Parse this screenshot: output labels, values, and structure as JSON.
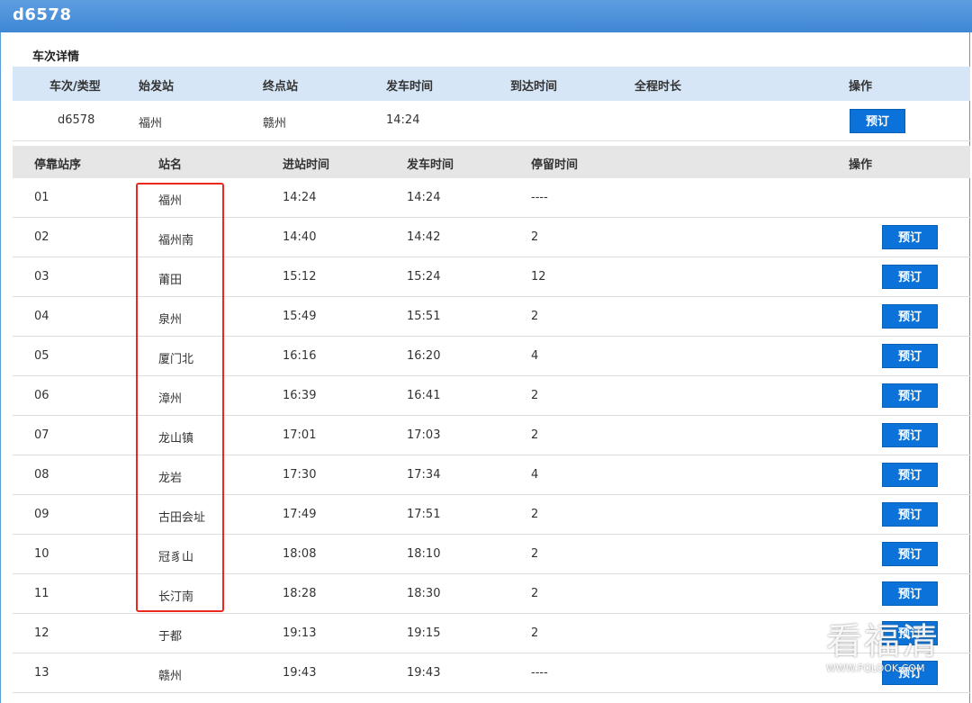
{
  "window": {
    "title": "d6578"
  },
  "section": {
    "label": "车次详情"
  },
  "train_header": {
    "columns": [
      "车次/类型",
      "始发站",
      "终点站",
      "发车时间",
      "到达时间",
      "全程时长",
      "操作"
    ]
  },
  "train_row": {
    "train_no": "d6578",
    "origin": "福州",
    "destination": "赣州",
    "depart": "14:24",
    "arrive": "",
    "duration": "",
    "book_label": "预订"
  },
  "stops_header": {
    "columns": [
      "停靠站序",
      "站名",
      "进站时间",
      "发车时间",
      "停留时间",
      "操作"
    ]
  },
  "stops": [
    {
      "seq": "01",
      "name": "福州",
      "arrive": "14:24",
      "depart": "14:24",
      "stay": "----",
      "book": ""
    },
    {
      "seq": "02",
      "name": "福州南",
      "arrive": "14:40",
      "depart": "14:42",
      "stay": "2",
      "book": "预订"
    },
    {
      "seq": "03",
      "name": "莆田",
      "arrive": "15:12",
      "depart": "15:24",
      "stay": "12",
      "book": "预订"
    },
    {
      "seq": "04",
      "name": "泉州",
      "arrive": "15:49",
      "depart": "15:51",
      "stay": "2",
      "book": "预订"
    },
    {
      "seq": "05",
      "name": "厦门北",
      "arrive": "16:16",
      "depart": "16:20",
      "stay": "4",
      "book": "预订"
    },
    {
      "seq": "06",
      "name": "漳州",
      "arrive": "16:39",
      "depart": "16:41",
      "stay": "2",
      "book": "预订"
    },
    {
      "seq": "07",
      "name": "龙山镇",
      "arrive": "17:01",
      "depart": "17:03",
      "stay": "2",
      "book": "预订"
    },
    {
      "seq": "08",
      "name": "龙岩",
      "arrive": "17:30",
      "depart": "17:34",
      "stay": "4",
      "book": "预订"
    },
    {
      "seq": "09",
      "name": "古田会址",
      "arrive": "17:49",
      "depart": "17:51",
      "stay": "2",
      "book": "预订"
    },
    {
      "seq": "10",
      "name": "冠豸山",
      "arrive": "18:08",
      "depart": "18:10",
      "stay": "2",
      "book": "预订"
    },
    {
      "seq": "11",
      "name": "长汀南",
      "arrive": "18:28",
      "depart": "18:30",
      "stay": "2",
      "book": "预订"
    },
    {
      "seq": "12",
      "name": "于都",
      "arrive": "19:13",
      "depart": "19:15",
      "stay": "2",
      "book": "预订"
    },
    {
      "seq": "13",
      "name": "赣州",
      "arrive": "19:43",
      "depart": "19:43",
      "stay": "----",
      "book": "预订"
    }
  ],
  "watermark": {
    "cn": "看福清",
    "en": "WWW.FQLOOK.COM"
  },
  "colors": {
    "title_bar": "#4a90d9",
    "header_blue": "#d6e6f6",
    "button": "#0a72d8",
    "highlight": "#e8291c"
  }
}
